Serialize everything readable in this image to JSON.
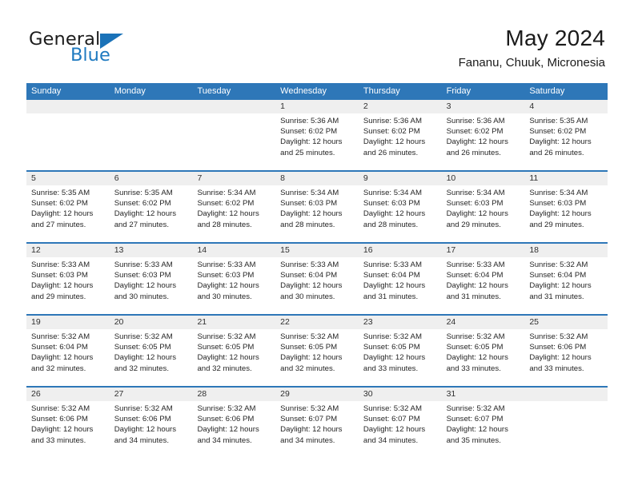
{
  "brand": {
    "name_top": "General",
    "name_bottom": "Blue",
    "accent_color": "#1a72b8"
  },
  "header": {
    "month_title": "May 2024",
    "location": "Fananu, Chuuk, Micronesia"
  },
  "theme": {
    "header_blue": "#2e77b8",
    "day_band_gray": "#efefef",
    "text_dark": "#1a1a1a"
  },
  "weekdays": [
    "Sunday",
    "Monday",
    "Tuesday",
    "Wednesday",
    "Thursday",
    "Friday",
    "Saturday"
  ],
  "labels": {
    "sunrise_prefix": "Sunrise:",
    "sunset_prefix": "Sunset:",
    "daylight_prefix": "Daylight:"
  },
  "weeks": [
    [
      {
        "day": "",
        "empty": true
      },
      {
        "day": "",
        "empty": true
      },
      {
        "day": "",
        "empty": true
      },
      {
        "day": "1",
        "sunrise": "Sunrise: 5:36 AM",
        "sunset": "Sunset: 6:02 PM",
        "daylight_1": "Daylight: 12 hours",
        "daylight_2": "and 25 minutes."
      },
      {
        "day": "2",
        "sunrise": "Sunrise: 5:36 AM",
        "sunset": "Sunset: 6:02 PM",
        "daylight_1": "Daylight: 12 hours",
        "daylight_2": "and 26 minutes."
      },
      {
        "day": "3",
        "sunrise": "Sunrise: 5:36 AM",
        "sunset": "Sunset: 6:02 PM",
        "daylight_1": "Daylight: 12 hours",
        "daylight_2": "and 26 minutes."
      },
      {
        "day": "4",
        "sunrise": "Sunrise: 5:35 AM",
        "sunset": "Sunset: 6:02 PM",
        "daylight_1": "Daylight: 12 hours",
        "daylight_2": "and 26 minutes."
      }
    ],
    [
      {
        "day": "5",
        "sunrise": "Sunrise: 5:35 AM",
        "sunset": "Sunset: 6:02 PM",
        "daylight_1": "Daylight: 12 hours",
        "daylight_2": "and 27 minutes."
      },
      {
        "day": "6",
        "sunrise": "Sunrise: 5:35 AM",
        "sunset": "Sunset: 6:02 PM",
        "daylight_1": "Daylight: 12 hours",
        "daylight_2": "and 27 minutes."
      },
      {
        "day": "7",
        "sunrise": "Sunrise: 5:34 AM",
        "sunset": "Sunset: 6:02 PM",
        "daylight_1": "Daylight: 12 hours",
        "daylight_2": "and 28 minutes."
      },
      {
        "day": "8",
        "sunrise": "Sunrise: 5:34 AM",
        "sunset": "Sunset: 6:03 PM",
        "daylight_1": "Daylight: 12 hours",
        "daylight_2": "and 28 minutes."
      },
      {
        "day": "9",
        "sunrise": "Sunrise: 5:34 AM",
        "sunset": "Sunset: 6:03 PM",
        "daylight_1": "Daylight: 12 hours",
        "daylight_2": "and 28 minutes."
      },
      {
        "day": "10",
        "sunrise": "Sunrise: 5:34 AM",
        "sunset": "Sunset: 6:03 PM",
        "daylight_1": "Daylight: 12 hours",
        "daylight_2": "and 29 minutes."
      },
      {
        "day": "11",
        "sunrise": "Sunrise: 5:34 AM",
        "sunset": "Sunset: 6:03 PM",
        "daylight_1": "Daylight: 12 hours",
        "daylight_2": "and 29 minutes."
      }
    ],
    [
      {
        "day": "12",
        "sunrise": "Sunrise: 5:33 AM",
        "sunset": "Sunset: 6:03 PM",
        "daylight_1": "Daylight: 12 hours",
        "daylight_2": "and 29 minutes."
      },
      {
        "day": "13",
        "sunrise": "Sunrise: 5:33 AM",
        "sunset": "Sunset: 6:03 PM",
        "daylight_1": "Daylight: 12 hours",
        "daylight_2": "and 30 minutes."
      },
      {
        "day": "14",
        "sunrise": "Sunrise: 5:33 AM",
        "sunset": "Sunset: 6:03 PM",
        "daylight_1": "Daylight: 12 hours",
        "daylight_2": "and 30 minutes."
      },
      {
        "day": "15",
        "sunrise": "Sunrise: 5:33 AM",
        "sunset": "Sunset: 6:04 PM",
        "daylight_1": "Daylight: 12 hours",
        "daylight_2": "and 30 minutes."
      },
      {
        "day": "16",
        "sunrise": "Sunrise: 5:33 AM",
        "sunset": "Sunset: 6:04 PM",
        "daylight_1": "Daylight: 12 hours",
        "daylight_2": "and 31 minutes."
      },
      {
        "day": "17",
        "sunrise": "Sunrise: 5:33 AM",
        "sunset": "Sunset: 6:04 PM",
        "daylight_1": "Daylight: 12 hours",
        "daylight_2": "and 31 minutes."
      },
      {
        "day": "18",
        "sunrise": "Sunrise: 5:32 AM",
        "sunset": "Sunset: 6:04 PM",
        "daylight_1": "Daylight: 12 hours",
        "daylight_2": "and 31 minutes."
      }
    ],
    [
      {
        "day": "19",
        "sunrise": "Sunrise: 5:32 AM",
        "sunset": "Sunset: 6:04 PM",
        "daylight_1": "Daylight: 12 hours",
        "daylight_2": "and 32 minutes."
      },
      {
        "day": "20",
        "sunrise": "Sunrise: 5:32 AM",
        "sunset": "Sunset: 6:05 PM",
        "daylight_1": "Daylight: 12 hours",
        "daylight_2": "and 32 minutes."
      },
      {
        "day": "21",
        "sunrise": "Sunrise: 5:32 AM",
        "sunset": "Sunset: 6:05 PM",
        "daylight_1": "Daylight: 12 hours",
        "daylight_2": "and 32 minutes."
      },
      {
        "day": "22",
        "sunrise": "Sunrise: 5:32 AM",
        "sunset": "Sunset: 6:05 PM",
        "daylight_1": "Daylight: 12 hours",
        "daylight_2": "and 32 minutes."
      },
      {
        "day": "23",
        "sunrise": "Sunrise: 5:32 AM",
        "sunset": "Sunset: 6:05 PM",
        "daylight_1": "Daylight: 12 hours",
        "daylight_2": "and 33 minutes."
      },
      {
        "day": "24",
        "sunrise": "Sunrise: 5:32 AM",
        "sunset": "Sunset: 6:05 PM",
        "daylight_1": "Daylight: 12 hours",
        "daylight_2": "and 33 minutes."
      },
      {
        "day": "25",
        "sunrise": "Sunrise: 5:32 AM",
        "sunset": "Sunset: 6:06 PM",
        "daylight_1": "Daylight: 12 hours",
        "daylight_2": "and 33 minutes."
      }
    ],
    [
      {
        "day": "26",
        "sunrise": "Sunrise: 5:32 AM",
        "sunset": "Sunset: 6:06 PM",
        "daylight_1": "Daylight: 12 hours",
        "daylight_2": "and 33 minutes."
      },
      {
        "day": "27",
        "sunrise": "Sunrise: 5:32 AM",
        "sunset": "Sunset: 6:06 PM",
        "daylight_1": "Daylight: 12 hours",
        "daylight_2": "and 34 minutes."
      },
      {
        "day": "28",
        "sunrise": "Sunrise: 5:32 AM",
        "sunset": "Sunset: 6:06 PM",
        "daylight_1": "Daylight: 12 hours",
        "daylight_2": "and 34 minutes."
      },
      {
        "day": "29",
        "sunrise": "Sunrise: 5:32 AM",
        "sunset": "Sunset: 6:07 PM",
        "daylight_1": "Daylight: 12 hours",
        "daylight_2": "and 34 minutes."
      },
      {
        "day": "30",
        "sunrise": "Sunrise: 5:32 AM",
        "sunset": "Sunset: 6:07 PM",
        "daylight_1": "Daylight: 12 hours",
        "daylight_2": "and 34 minutes."
      },
      {
        "day": "31",
        "sunrise": "Sunrise: 5:32 AM",
        "sunset": "Sunset: 6:07 PM",
        "daylight_1": "Daylight: 12 hours",
        "daylight_2": "and 35 minutes."
      },
      {
        "day": "",
        "empty": true
      }
    ]
  ]
}
